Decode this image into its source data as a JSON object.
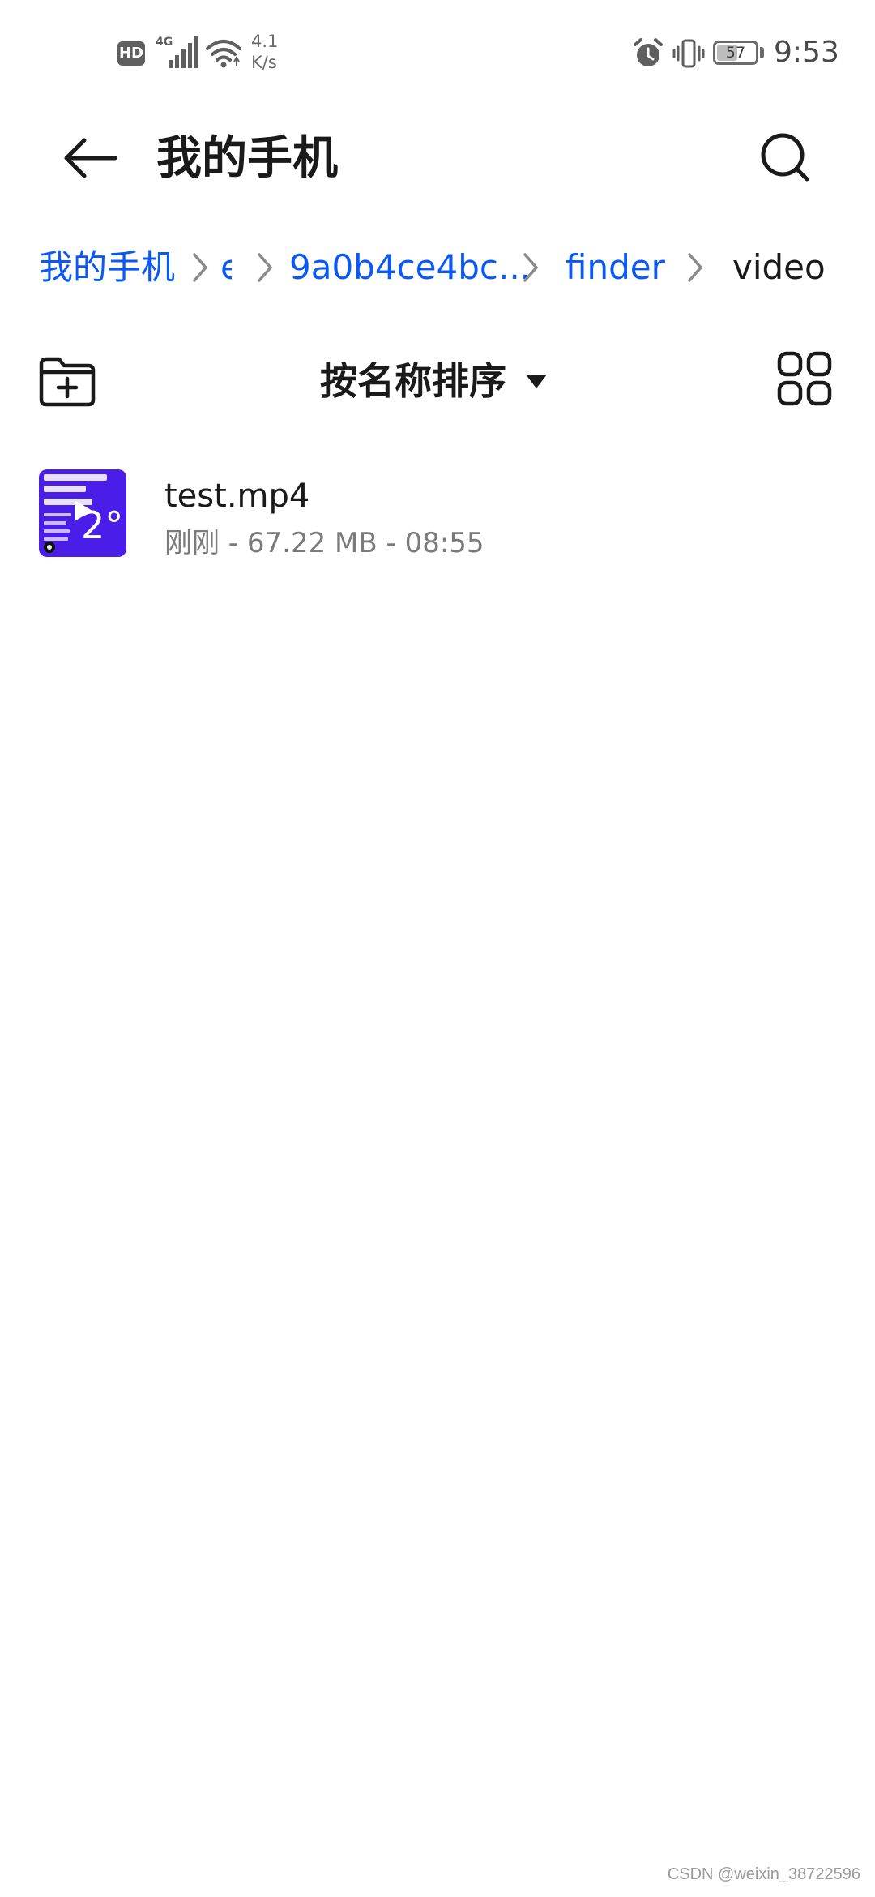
{
  "status_bar": {
    "hd_badge": "HD",
    "network_type": "4G",
    "speed_value": "4.1",
    "speed_unit": "K/s",
    "battery_level": "57",
    "battery_fraction": 0.57,
    "time": "9:53"
  },
  "header": {
    "title": "我的手机",
    "icons": {
      "back": "arrow-left-icon",
      "search": "search-icon"
    }
  },
  "breadcrumb": {
    "items": [
      {
        "label": "我的手机",
        "current": false
      },
      {
        "label": "e",
        "current": false
      },
      {
        "label": "9a0b4ce4bc...",
        "current": false
      },
      {
        "label": "finder",
        "current": false
      },
      {
        "label": "video",
        "current": true
      }
    ],
    "colors": {
      "link": "#0a59f7",
      "current": "#1a1a1a"
    }
  },
  "toolbar": {
    "sort_label": "按名称排序",
    "icons": {
      "new_folder": "folder-plus-icon",
      "view_toggle": "grid-view-icon"
    }
  },
  "files": [
    {
      "name": "test.mp4",
      "meta": "刚刚 - 67.22 MB - 08:55",
      "thumbnail_digit": "2°",
      "thumbnail_color": "#4a1ee8"
    }
  ],
  "watermark": "CSDN @weixin_38722596"
}
